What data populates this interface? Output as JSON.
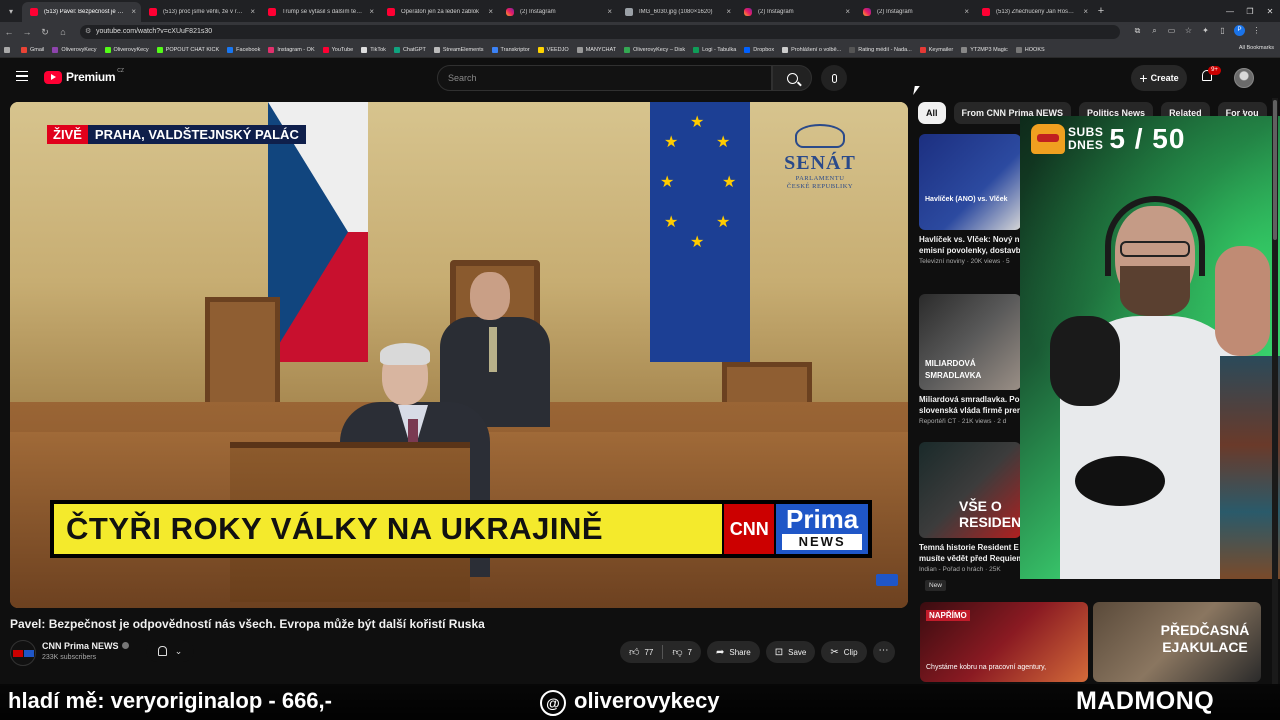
{
  "browser": {
    "tabs": [
      {
        "title": "(513) Pavel: Bezpečnost je odp",
        "favicon": "youtube-icon",
        "active": true
      },
      {
        "title": "(513) proč jsme věřili, že v roce",
        "favicon": "youtube-icon",
        "active": false
      },
      {
        "title": "Trump se vytasil s dalším termí",
        "favicon": "youtube-icon",
        "active": false
      },
      {
        "title": "Operátoři jen za leden zablok",
        "favicon": "youtube-icon",
        "active": false
      },
      {
        "title": "(2) Instagram",
        "favicon": "instagram-icon",
        "active": false
      },
      {
        "title": "IMG_6030.jpg (1080×1620)",
        "favicon": "image-icon",
        "active": false
      },
      {
        "title": "(2) Instagram",
        "favicon": "instagram-icon",
        "active": false
      },
      {
        "title": "(2) Instagram",
        "favicon": "instagram-icon",
        "active": false
      },
      {
        "title": "(513) Zhechucený Jan Rosák zk",
        "favicon": "youtube-icon",
        "active": false
      }
    ],
    "url": "youtube.com/watch?v=cXUuF821s30",
    "bookmarks": [
      "Gmail",
      "OliverovyKecy",
      "OliverovyKecy",
      "POPOUT CHAT KICK",
      "Facebook",
      "Instagram - OK",
      "YouTube",
      "TikTok",
      "ChatGPT",
      "StreamElements",
      "Transkriptor",
      "VEEDJO",
      "MANYCHAT",
      "OliverovyKecy – Disk",
      "Logi - Tabulka",
      "Dropbox",
      "Prohlášení o volbě...",
      "Rating médií - Nada...",
      "Keymailer",
      "YT2MP3 Magic",
      "HOOKS"
    ],
    "bookmarks_right": "All Bookmarks"
  },
  "youtube": {
    "logo_text": "Premium",
    "region": "CZ",
    "search_placeholder": "Search",
    "create_label": "Create",
    "notif_count": "9+"
  },
  "video": {
    "live_label": "ŽIVĚ",
    "location": "PRAHA, VALDŠTEJNSKÝ PALÁC",
    "banner": "ČTYŘI ROKY VÁLKY NA UKRAJINĚ",
    "cnn": "CNN",
    "prima": "Prima",
    "news": "NEWS",
    "senat_big": "SENÁT",
    "senat_small_1": "PARLAMENTU",
    "senat_small_2": "ČESKÉ REPUBLIKY",
    "title": "Pavel: Bezpečnost je odpovědností nás všech. Evropa může být další kořistí Ruska",
    "channel": "CNN Prima NEWS",
    "subscribers": "233K subscribers",
    "likes": "77",
    "dislikes": "7",
    "share": "Share",
    "save": "Save",
    "clip": "Clip"
  },
  "chips": [
    "All",
    "From CNN Prima NEWS",
    "Politics News",
    "Related",
    "For you"
  ],
  "recommendations": [
    {
      "title": "Havlíček vs. Vlček: Nový n",
      "title2": "emisní povolenky, dostavb",
      "meta": "Televizní noviny · 20K views · 5",
      "thumb_text": "Havlíček (ANO) vs. Vlček"
    },
    {
      "title": "Miliardová smradlavka. Po",
      "title2": "slovenská vláda firmě prer",
      "meta": "Reportéři ČT · 21K views · 2 d",
      "thumb_text": "MILIARDOVÁ SMRADLAVKA"
    },
    {
      "title": "Temná historie Resident E",
      "title2": "musíte vědět před Requiem",
      "meta": "Indian - Pořad o hrách · 25K",
      "thumb_text": "VŠE O RESIDENT"
    }
  ],
  "new_badge": "New",
  "bottom_thumbs": [
    {
      "label": "NAPŘÍMO",
      "caption": "Chystáme kobru na pracovní agentury,"
    },
    {
      "caption": "PŘEDČASNÁ EJAKULACE"
    }
  ],
  "stream_overlay": {
    "subs_label_1": "SUBS",
    "subs_label_2": "DNES",
    "subs_count": "5 / 50",
    "left_text": "hladí mě: veryoriginalop - 666,-",
    "instagram_handle": "oliverovykecy",
    "brand": "MADMONQ"
  }
}
